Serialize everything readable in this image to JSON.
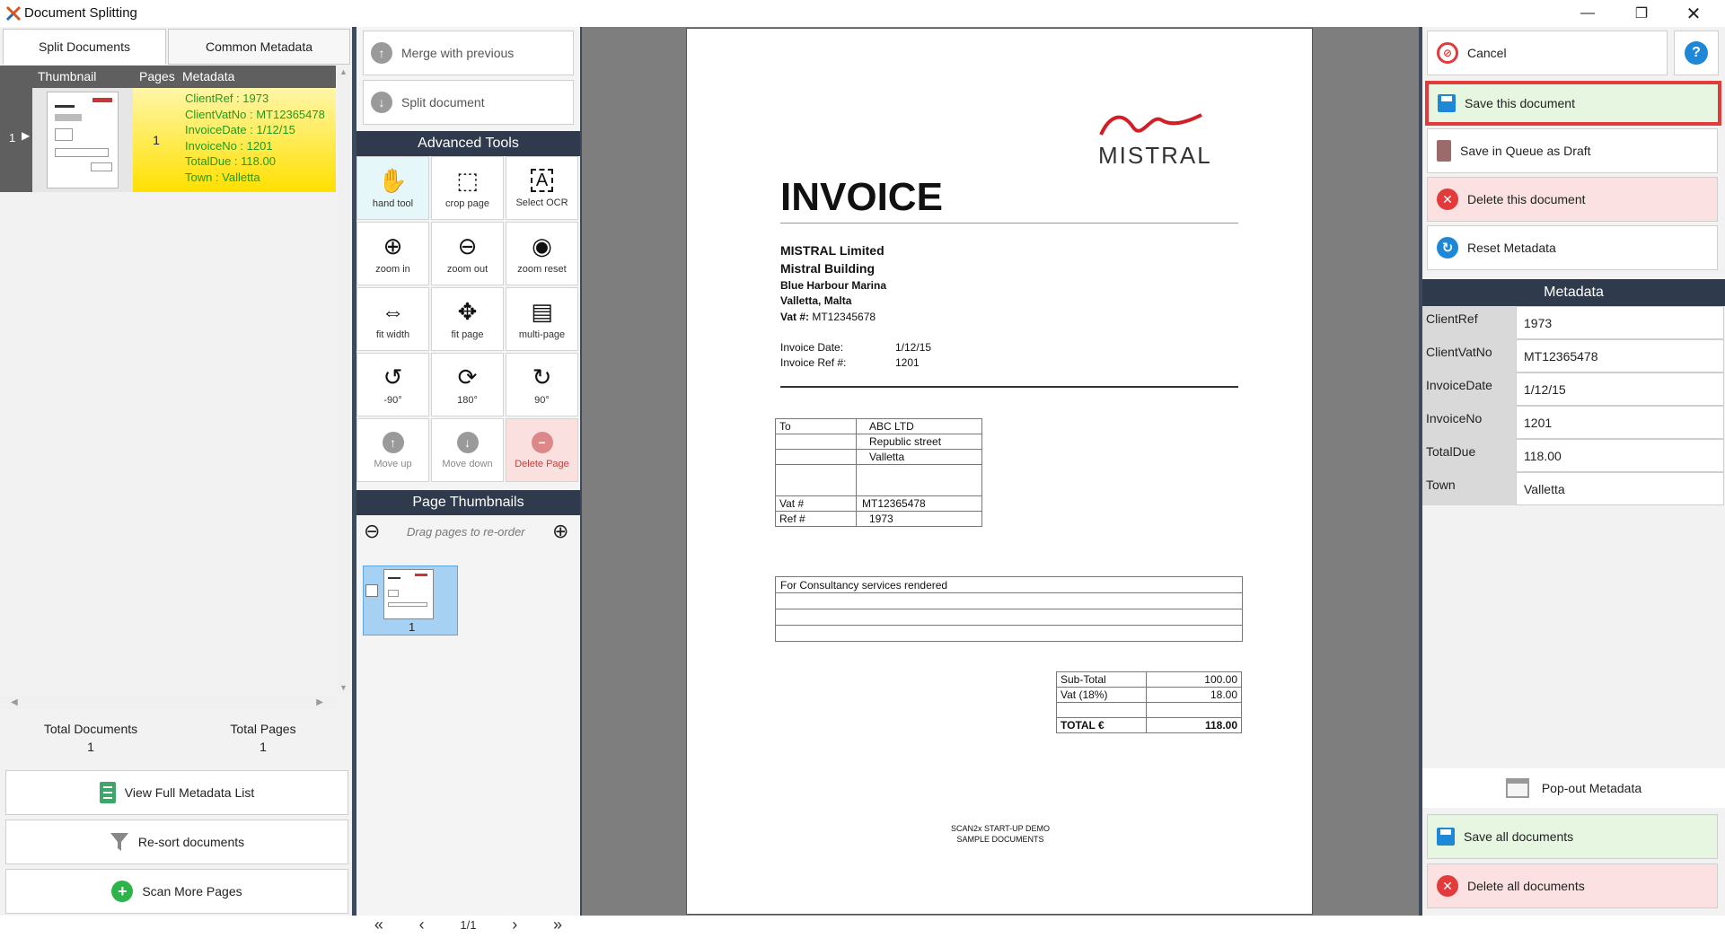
{
  "window": {
    "title": "Document Splitting"
  },
  "left": {
    "tabs": [
      "Split Documents",
      "Common Metadata"
    ],
    "columns": {
      "thumbnail": "Thumbnail",
      "pages": "Pages",
      "metadata": "Metadata"
    },
    "row": {
      "index": "1",
      "pages": "1",
      "metadata": [
        "ClientRef : 1973",
        "ClientVatNo : MT12365478",
        "InvoiceDate : 1/12/15",
        "InvoiceNo : 1201",
        "TotalDue : 118.00",
        "Town : Valletta"
      ]
    },
    "totals": {
      "docs_label": "Total Documents",
      "docs_value": "1",
      "pages_label": "Total Pages",
      "pages_value": "1"
    },
    "buttons": {
      "view_meta": "View Full Metadata List",
      "resort": "Re-sort documents",
      "scan_more": "Scan More Pages"
    }
  },
  "tools": {
    "merge": "Merge with previous",
    "split": "Split document",
    "advanced_header": "Advanced Tools",
    "items": {
      "hand": "hand tool",
      "crop": "crop page",
      "ocr": "Select OCR",
      "zoom_in": "zoom in",
      "zoom_out": "zoom out",
      "zoom_reset": "zoom reset",
      "fit_width": "fit width",
      "fit_page": "fit page",
      "multi_page": "multi-page",
      "rot_m90": "-90°",
      "rot_180": "180°",
      "rot_90": "90°",
      "move_up": "Move up",
      "move_down": "Move down",
      "delete_page": "Delete Page"
    },
    "thumbs_header": "Page Thumbnails",
    "drag_hint": "Drag pages to re-order",
    "thumb_number": "1",
    "pager": "1/1"
  },
  "invoice": {
    "brand": "MISTRAL",
    "heading": "INVOICE",
    "company": [
      "MISTRAL Limited",
      "Mistral Building"
    ],
    "address": [
      "Blue Harbour Marina",
      "Valletta, Malta"
    ],
    "vat_label": "Vat #:",
    "vat_value": "MT12345678",
    "date_label": "Invoice Date:",
    "date_value": "1/12/15",
    "ref_label": "Invoice Ref #:",
    "ref_value": "1201",
    "to_label": "To",
    "to_lines": [
      "ABC LTD",
      "Republic street",
      "Valletta"
    ],
    "cust_vat_label": "Vat #",
    "cust_vat_value": "MT12365478",
    "cust_ref_label": "Ref #",
    "cust_ref_value": "1973",
    "service": "For Consultancy services rendered",
    "subtotal_label": "Sub-Total",
    "subtotal_value": "100.00",
    "vat18_label": "Vat (18%)",
    "vat18_value": "18.00",
    "total_label": "TOTAL €",
    "total_value": "118.00",
    "footer1": "SCAN2x START-UP DEMO",
    "footer2": "SAMPLE DOCUMENTS"
  },
  "right": {
    "cancel": "Cancel",
    "save_doc": "Save this document",
    "save_queue": "Save in Queue as Draft",
    "delete_doc": "Delete this document",
    "reset_meta": "Reset Metadata",
    "meta_header": "Metadata",
    "fields": [
      {
        "label": "ClientRef",
        "value": "1973"
      },
      {
        "label": "ClientVatNo",
        "value": "MT12365478"
      },
      {
        "label": "InvoiceDate",
        "value": "1/12/15"
      },
      {
        "label": "InvoiceNo",
        "value": "1201"
      },
      {
        "label": "TotalDue",
        "value": "118.00"
      },
      {
        "label": "Town",
        "value": "Valletta"
      }
    ],
    "popout": "Pop-out Metadata",
    "save_all": "Save all documents",
    "delete_all": "Delete all documents"
  },
  "colors": {
    "accent_dark": "#2f3b4c",
    "highlight": "#ffe000",
    "meta_text": "#229a22",
    "save_green": "#e7f6e1",
    "delete_red": "#fbe1e1",
    "focus_outline": "#e23b3b"
  }
}
